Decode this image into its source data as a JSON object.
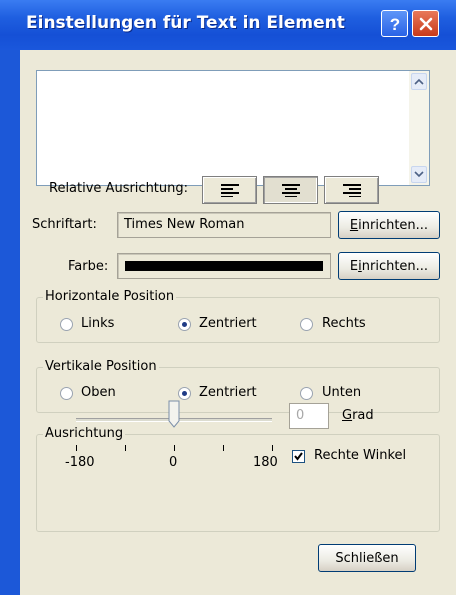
{
  "window": {
    "title": "Einstellungen für Text in Element",
    "help_icon": "help-icon",
    "close_icon": "close-icon"
  },
  "text_input": {
    "value": ""
  },
  "relative_alignment": {
    "label": "Relative Ausrichtung:",
    "buttons": [
      {
        "name": "align-left",
        "icon": "align-left-icon"
      },
      {
        "name": "align-center",
        "icon": "align-center-icon",
        "pressed": true
      },
      {
        "name": "align-right",
        "icon": "align-right-icon"
      }
    ]
  },
  "font": {
    "label": "Schriftart:",
    "value": "Times New Roman",
    "button_label": "Einrichten...",
    "button_mnemonic": "E"
  },
  "color": {
    "label": "Farbe:",
    "value": "#000000",
    "button_label": "Einrichten...",
    "button_mnemonic": "i"
  },
  "horizontal_position": {
    "legend": "Horizontale Position",
    "options": [
      {
        "label": "Links",
        "checked": false
      },
      {
        "label": "Zentriert",
        "checked": true
      },
      {
        "label": "Rechts",
        "checked": false
      }
    ]
  },
  "vertical_position": {
    "legend": "Vertikale Position",
    "options": [
      {
        "label": "Oben",
        "checked": false
      },
      {
        "label": "Zentriert",
        "checked": true
      },
      {
        "label": "Unten",
        "checked": false
      }
    ]
  },
  "orientation": {
    "legend": "Ausrichtung",
    "slider": {
      "min": -180,
      "max": 180,
      "value": 0
    },
    "tick_labels": [
      "-180",
      "0",
      "180"
    ],
    "degree_value": "0",
    "degree_label": "Grad",
    "right_angle_label": "Rechte Winkel",
    "right_angle_checked": true
  },
  "close_button": {
    "label": "Schließen"
  },
  "colors": {
    "titlebar": "#1f5fe0",
    "dialog_bg": "#ece9d8",
    "close_red": "#c83a1a"
  }
}
